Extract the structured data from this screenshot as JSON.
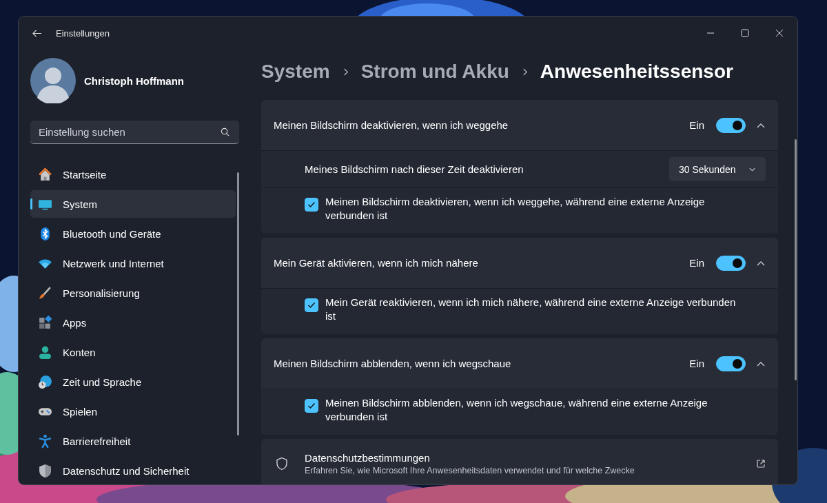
{
  "window": {
    "title": "Einstellungen"
  },
  "user": {
    "name": "Christoph Hoffmann"
  },
  "search": {
    "placeholder": "Einstellung suchen"
  },
  "sidebar": {
    "items": [
      {
        "label": "Startseite",
        "selected": false
      },
      {
        "label": "System",
        "selected": true
      },
      {
        "label": "Bluetooth und Geräte",
        "selected": false
      },
      {
        "label": "Netzwerk und Internet",
        "selected": false
      },
      {
        "label": "Personalisierung",
        "selected": false
      },
      {
        "label": "Apps",
        "selected": false
      },
      {
        "label": "Konten",
        "selected": false
      },
      {
        "label": "Zeit und Sprache",
        "selected": false
      },
      {
        "label": "Spielen",
        "selected": false
      },
      {
        "label": "Barrierefreiheit",
        "selected": false
      },
      {
        "label": "Datenschutz und Sicherheit",
        "selected": false
      }
    ]
  },
  "breadcrumb": [
    "System",
    "Strom und Akku",
    "Anwesenheitssensor"
  ],
  "sections": [
    {
      "title": "Meinen Bildschirm deaktivieren, wenn ich weggehe",
      "state_label": "Ein",
      "on": true,
      "expanded": true,
      "rows": [
        {
          "kind": "dropdown",
          "label": "Meines Bildschirm nach dieser Zeit deaktivieren",
          "value": "30 Sekunden"
        },
        {
          "kind": "checkbox",
          "label": "Meinen Bildschirm deaktivieren, wenn ich weggehe, während eine externe Anzeige verbunden ist",
          "checked": true
        }
      ]
    },
    {
      "title": "Mein Gerät aktivieren, wenn ich mich nähere",
      "state_label": "Ein",
      "on": true,
      "expanded": true,
      "rows": [
        {
          "kind": "checkbox",
          "label": "Mein Gerät reaktivieren, wenn ich mich nähere, während eine externe Anzeige verbunden ist",
          "checked": true
        }
      ]
    },
    {
      "title": "Meinen Bildschirm abblenden, wenn ich wegschaue",
      "state_label": "Ein",
      "on": true,
      "expanded": true,
      "rows": [
        {
          "kind": "checkbox",
          "label": "Meinen Bildschirm abblenden, wenn ich wegschaue, während eine externe Anzeige verbunden ist",
          "checked": true
        }
      ]
    }
  ],
  "privacy": {
    "title": "Datenschutzbestimmungen",
    "description": "Erfahren Sie, wie Microsoft Ihre Anwesenheitsdaten verwendet und für welche Zwecke"
  }
}
